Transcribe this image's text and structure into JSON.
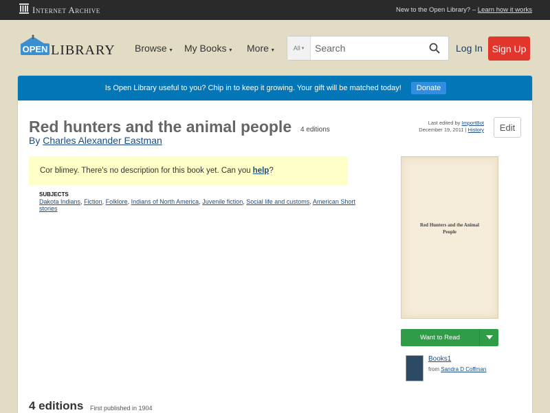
{
  "ia_bar": {
    "logo_text": "Internet Archive",
    "prompt": "New to the Open Library?",
    "link": "Learn how it works"
  },
  "header": {
    "logo_open": "OPEN",
    "logo_library": "LIBRARY",
    "nav": [
      "Browse",
      "My Books",
      "More"
    ],
    "search_scope": "All",
    "search_placeholder": "Search",
    "login": "Log In",
    "signup": "Sign Up"
  },
  "donate": {
    "message": "Is Open Library useful to you? Chip in to keep it growing. Your gift will be matched today!",
    "button": "Donate"
  },
  "book": {
    "title": "Red hunters and the animal people",
    "editions_count": "4 editions",
    "by": "By",
    "author": "Charles Alexander Eastman",
    "last_edited_label": "Last edited by",
    "last_edited_user": "ImportBot",
    "last_edited_date": "December 19, 2011",
    "history": "History",
    "edit": "Edit",
    "description_text": "Cor blimey. There's no description for this book yet. Can you",
    "description_link": "help",
    "description_end": "?",
    "subjects_title": "SUBJECTS",
    "subjects": [
      "Dakota Indians",
      "Fiction",
      "Folklore",
      "Indians of North America",
      "Juvenile fiction",
      "Social life and customs",
      "American Short stories"
    ],
    "cover_line1": "Red Hunters and the Animal",
    "cover_line2": "People"
  },
  "sidebar": {
    "want_to_read": "Want to Read",
    "list_title": "Books1",
    "list_from": "from",
    "list_owner": "Sandra D Coffman"
  },
  "editions": {
    "heading": "4 editions",
    "first_published": "First published in 1904"
  }
}
